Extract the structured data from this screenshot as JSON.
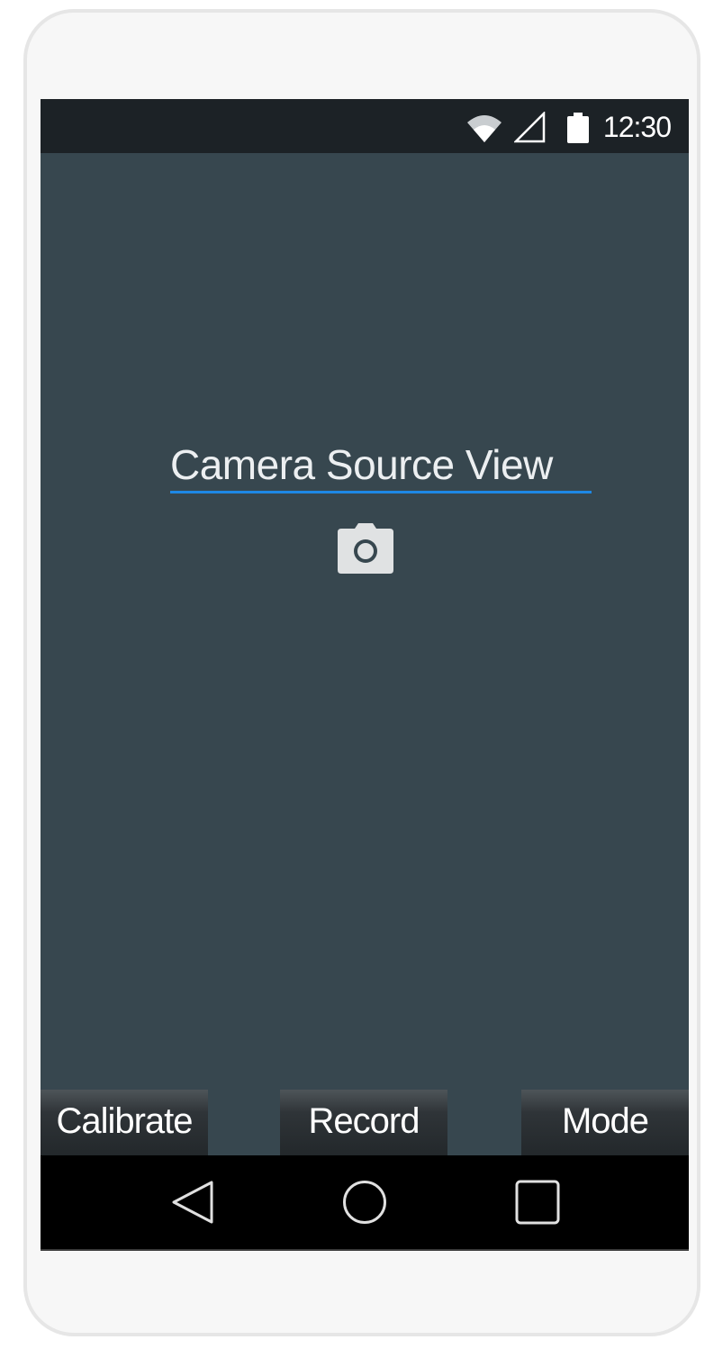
{
  "status_bar": {
    "time": "12:30",
    "icons": [
      "wifi-icon",
      "cell-signal-icon",
      "battery-icon"
    ]
  },
  "main": {
    "title": "Camera Source View",
    "icon": "camera-icon"
  },
  "buttons": {
    "calibrate": "Calibrate",
    "record": "Record",
    "mode": "Mode"
  },
  "nav_bar": {
    "icons": [
      "back-icon",
      "home-icon",
      "recents-icon"
    ]
  },
  "colors": {
    "screen_background": "#37474f",
    "status_bar": "#1c2226",
    "accent_underline": "#1e88e5",
    "nav_bar": "#000000"
  }
}
